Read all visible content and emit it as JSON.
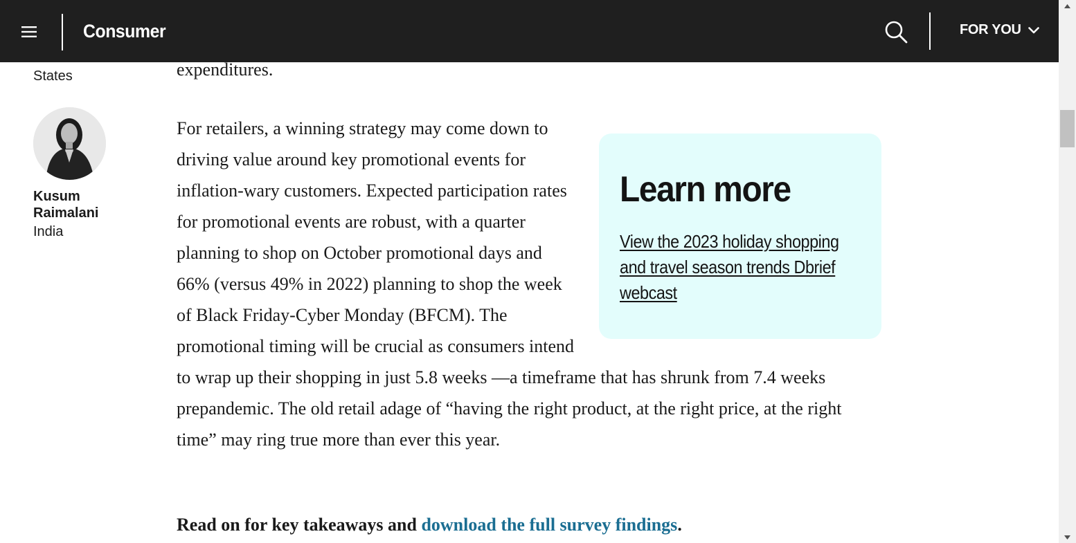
{
  "header": {
    "brand": "Consumer",
    "for_you": "FOR YOU",
    "icons": {
      "menu": "hamburger-menu-icon",
      "search": "search-icon",
      "dropdown": "chevron-down-icon"
    }
  },
  "authors": {
    "previous_location": "States",
    "current": {
      "name": "Kusum Raimalani",
      "location": "India"
    }
  },
  "article": {
    "top_fragment": "expenditures.",
    "main_paragraph": "For retailers, a winning strategy may come down to driving value around key promotional events for inflation-wary customers. Expected participation rates for promotional events are robust, with a quarter planning to shop on October promotional days and 66% (versus 49% in 2022) planning to shop the week of Black Friday-Cyber Monday (BFCM). The promotional timing will be crucial as consumers intend to wrap up their shopping in just 5.8 weeks —a timeframe that has shrunk from 7.4 weeks prepandemic. The old retail adage of “having the right product, at the right price, at the right time” may ring true more than ever this year.",
    "read_on_prefix": "Read on for key takeaways and ",
    "read_on_link": "download the full survey findings",
    "read_on_suffix": "."
  },
  "learn_more": {
    "title": "Learn more",
    "link": "View the 2023 holiday shopping and travel season trends Dbrief webcast"
  },
  "colors": {
    "topbar": "#1f1f1f",
    "callout_bg": "#e3fdfc",
    "link": "#1b6e92"
  }
}
